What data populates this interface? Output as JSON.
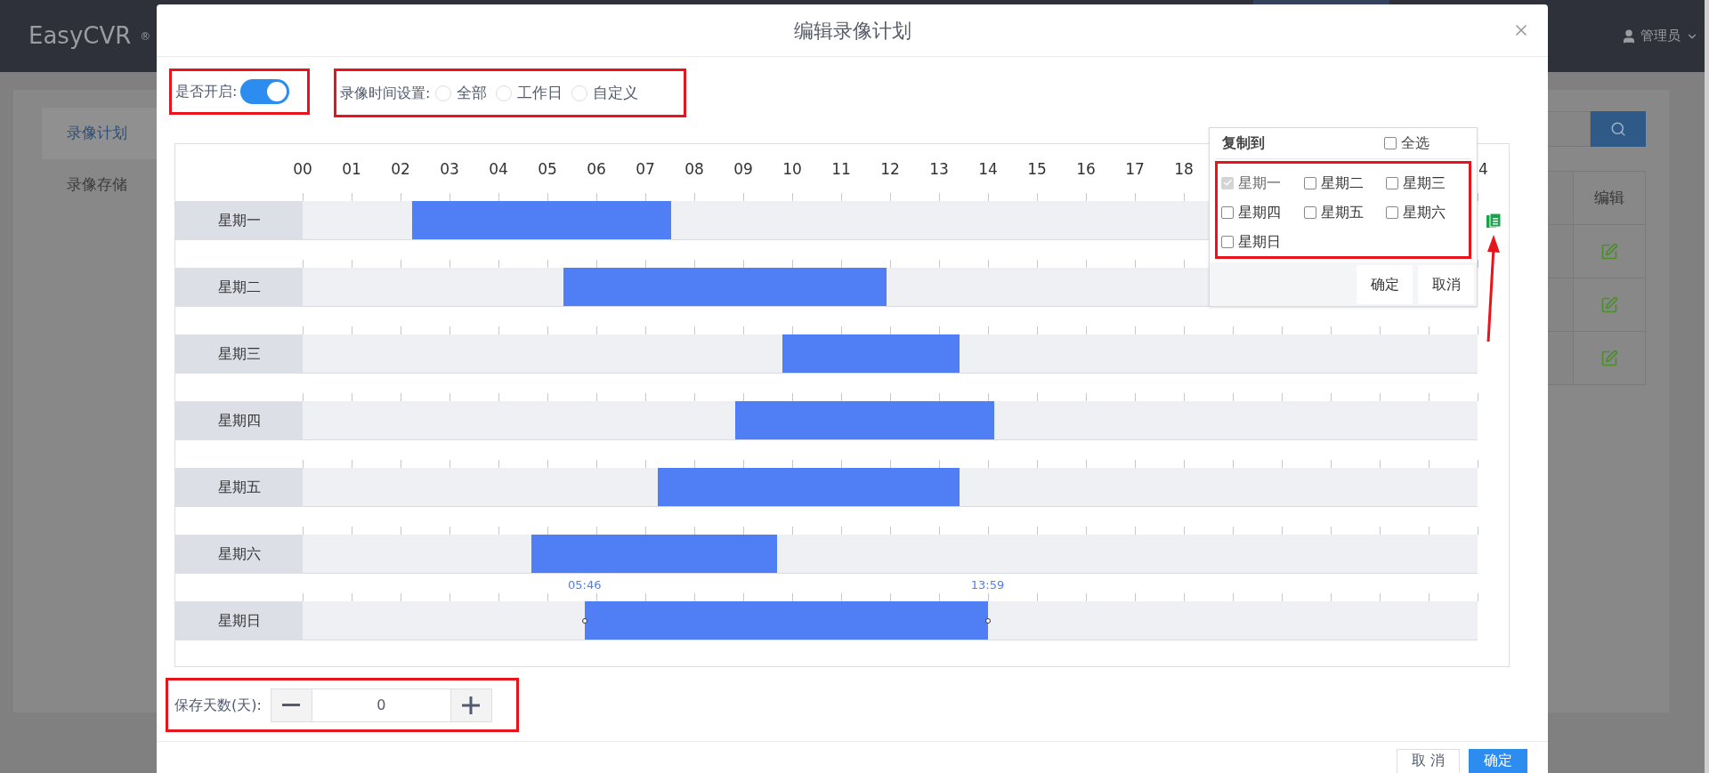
{
  "app": {
    "logo": "EasyCVR",
    "logo_mark": "®",
    "user": "管理员"
  },
  "sidebar": {
    "items": [
      {
        "label": "录像计划",
        "selected": true
      },
      {
        "label": "录像存储",
        "selected": false
      }
    ]
  },
  "table": {
    "columns": [
      "编辑"
    ],
    "rows": [
      {
        "editable": true
      },
      {
        "editable": true
      },
      {
        "editable": true
      }
    ]
  },
  "dialog": {
    "title": "编辑录像计划",
    "enable": {
      "label": "是否开启:",
      "on": true
    },
    "record_time": {
      "label": "录像时间设置:",
      "options": [
        {
          "label": "全部",
          "selected": false
        },
        {
          "label": "工作日",
          "selected": false
        },
        {
          "label": "自定义",
          "selected": false
        }
      ]
    },
    "schedule": {
      "hours": [
        "00",
        "01",
        "02",
        "03",
        "04",
        "05",
        "06",
        "07",
        "08",
        "09",
        "10",
        "11",
        "12",
        "13",
        "14",
        "15",
        "16",
        "17",
        "18"
      ],
      "hour_end": "4",
      "days": [
        {
          "label": "星期一",
          "start": {
            "level": 0.093
          },
          "end": {
            "level": 0.314
          },
          "selected": false,
          "copy_icon": true
        },
        {
          "label": "星期二",
          "start": {
            "level": 0.222
          },
          "end": {
            "level": 0.497
          },
          "selected": false,
          "copy_icon": false
        },
        {
          "label": "星期三",
          "start": {
            "level": 0.408
          },
          "end": {
            "level": 0.559
          },
          "selected": false,
          "copy_icon": false
        },
        {
          "label": "星期四",
          "start": {
            "level": 0.368
          },
          "end": {
            "level": 0.589
          },
          "selected": false,
          "copy_icon": false
        },
        {
          "label": "星期五",
          "start": {
            "level": 0.302
          },
          "end": {
            "level": 0.559
          },
          "selected": false,
          "copy_icon": false
        },
        {
          "label": "星期六",
          "start": {
            "level": 0.195
          },
          "end": {
            "level": 0.404
          },
          "selected": false,
          "copy_icon": false
        },
        {
          "label": "星期日",
          "start": {
            "level": 0.24,
            "label": "05:46"
          },
          "end": {
            "level": 0.583,
            "label": "13:59"
          },
          "selected": true,
          "copy_icon": false
        }
      ]
    },
    "copy_popup": {
      "title": "复制到",
      "select_all": {
        "label": "全选",
        "checked": false
      },
      "days": [
        {
          "label": "星期一",
          "checked": true,
          "disabled": true
        },
        {
          "label": "星期二",
          "checked": false,
          "disabled": false
        },
        {
          "label": "星期三",
          "checked": false,
          "disabled": false
        },
        {
          "label": "星期四",
          "checked": false,
          "disabled": false
        },
        {
          "label": "星期五",
          "checked": false,
          "disabled": false
        },
        {
          "label": "星期六",
          "checked": false,
          "disabled": false
        },
        {
          "label": "星期日",
          "checked": false,
          "disabled": false
        }
      ],
      "buttons": [
        "确定",
        "取消"
      ]
    },
    "retention": {
      "label": "保存天数(天):",
      "value": "0"
    },
    "buttons": [
      {
        "label": "取 消",
        "kind": "default"
      },
      {
        "label": "确定",
        "kind": "primary"
      }
    ]
  }
}
